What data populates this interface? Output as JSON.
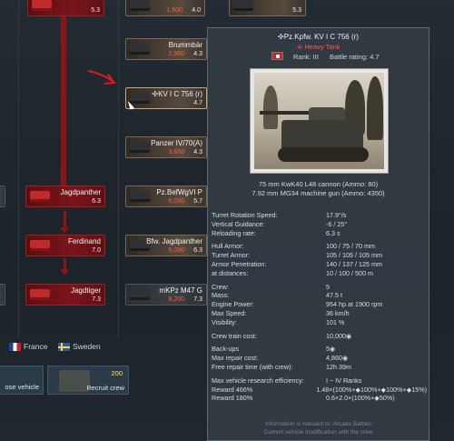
{
  "tooltip": {
    "title": "✣Pz.Kpfw. KV I C 756 (r)",
    "class_label": "☠ Heavy Tank",
    "rank": "Rank: III",
    "battle_rating": "Battle rating: 4.7",
    "weapon_main": "75 mm KwK40 L48 cannon (Ammo: 80)",
    "weapon_mg": "7.92 mm MG34 machine gun (Ammo: 4350)",
    "stats1": [
      {
        "k": "Turret Rotation Speed:",
        "v": "17.9°/s"
      },
      {
        "k": "Vertical Guidance:",
        "v": "-6 / 25°"
      },
      {
        "k": "Reloading rate:",
        "v": "6.3 s"
      }
    ],
    "stats2": [
      {
        "k": "Hull Armor:",
        "v": "100 / 75 / 70 mm"
      },
      {
        "k": "Turret Armor:",
        "v": "105 / 105 / 105 mm"
      },
      {
        "k": "Armor Penetration:",
        "v": "140 / 137 / 125 mm"
      },
      {
        "k": "at distances:",
        "v": "10 / 100 / 500 m"
      }
    ],
    "stats3": [
      {
        "k": "Crew:",
        "v": "5"
      },
      {
        "k": "Mass:",
        "v": "47.5 t"
      },
      {
        "k": "Engine Power:",
        "v": "954 hp at 1900 rpm"
      },
      {
        "k": "Max Speed:",
        "v": "36 km/h"
      },
      {
        "k": "Visibility:",
        "v": "101 %"
      }
    ],
    "crew_train_label": "Crew train cost:",
    "crew_train_value": "10,000◉",
    "stats4": [
      {
        "k": "Back-ups",
        "v": "5◉"
      },
      {
        "k": "Max repair cost:",
        "v": "4,860◉"
      },
      {
        "k": "Free repair time (with crew):",
        "v": "12h 39m"
      }
    ],
    "research_label": "Max vehicle research efficiency:",
    "research_value": "I ~ IV Ranks",
    "reward1_label": "Reward 466%",
    "reward1_value": "1.48×(100%+◆100%+◆100%+◆15%)",
    "reward2_label": "Reward 180%",
    "reward2_value": "0.6×2.0×(100%+◆50%)",
    "footnote1": "Information is relevant to: Arcade Battles",
    "footnote2": "Current vehicle modification with the crew"
  },
  "cards": {
    "top_left": {
      "cost": "5.3"
    },
    "top_mid": {
      "cost": "1,600",
      "br": "4.0"
    },
    "top_right": {
      "br": "5.3"
    },
    "brummbar": {
      "name": "Brummbär",
      "cost": "2,980",
      "br": "4.3"
    },
    "kv": {
      "name": "✣KV I C 756 (r)",
      "br": "4.7"
    },
    "panzer4_70": {
      "name": "Panzer IV/70(A)",
      "cost": "3,850",
      "br": "4.3"
    },
    "jagdpanther": {
      "name": "Jagdpanther",
      "br": "6.3"
    },
    "pzbefwg": {
      "name": "Pz.BefWgVI P",
      "cost": "6,090",
      "br": "5.7"
    },
    "ferdinand": {
      "name": "Ferdinand",
      "br": "7.0"
    },
    "bfw_jagdpanther": {
      "name": "Bfw. Jagdpanther",
      "cost": "6,090",
      "br": "6.3"
    },
    "jagdtiger": {
      "name": "Jagdtiger",
      "br": "7.3"
    },
    "mkpz": {
      "name": "mKPz M47 G",
      "cost": "8,200",
      "br": "7.3"
    }
  },
  "nations": {
    "france": "France",
    "sweden": "Sweden"
  },
  "buttons": {
    "vehicle": "ose vehicle",
    "recruit": "Recruit crew",
    "recruit_cost": "200"
  },
  "colors": {
    "elite_red": "#7a151a",
    "tooltip_bg": "#323a42",
    "heavy_tank_red": "#ff5a50"
  }
}
